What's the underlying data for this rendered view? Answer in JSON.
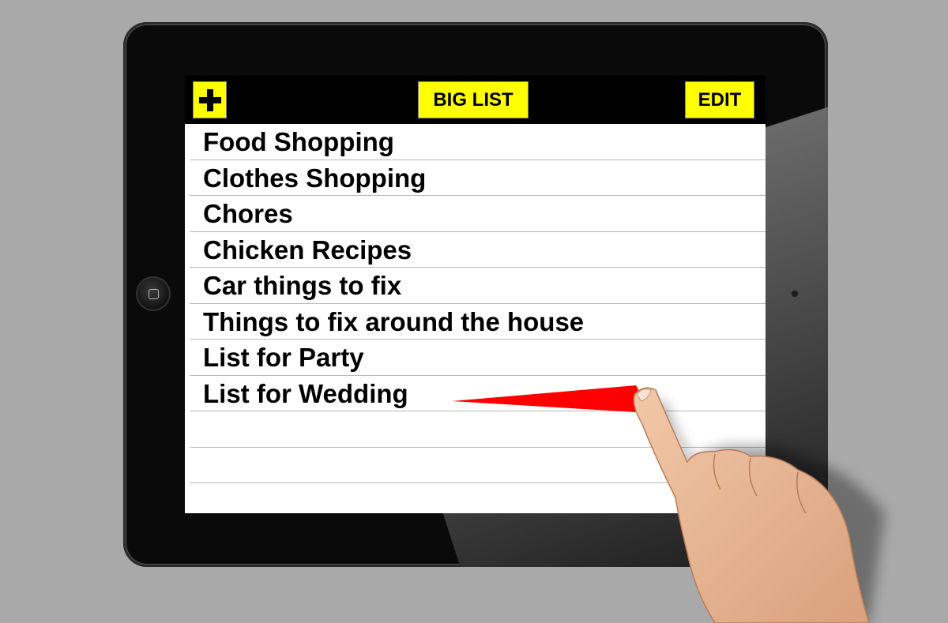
{
  "toolbar": {
    "add_icon": "plus-icon",
    "title": "BIG LIST",
    "edit_label": "EDIT",
    "button_color": "#ffff00"
  },
  "list": {
    "items": [
      "Food Shopping",
      "Clothes Shopping",
      "Chores",
      "Chicken Recipes",
      "Car things to fix",
      "Things to fix around the house",
      "List for Party",
      "List for Wedding",
      "",
      ""
    ]
  },
  "accent_colors": {
    "pointer_arrow": "#ff0000"
  }
}
